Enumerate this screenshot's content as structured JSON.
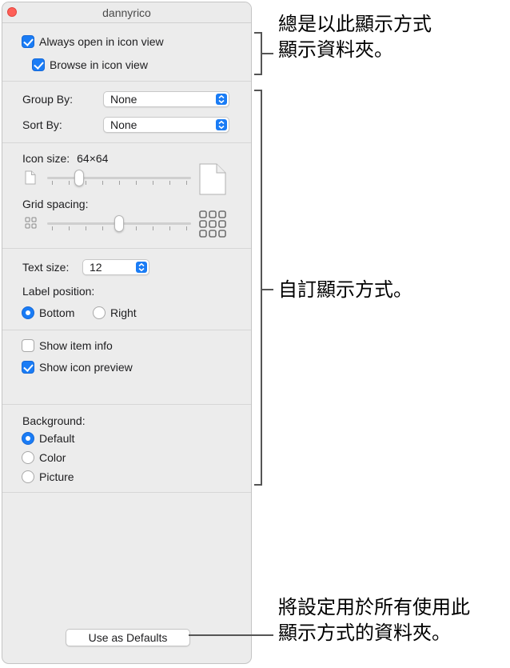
{
  "window": {
    "title": "dannyrico"
  },
  "view": {
    "always_open_label": "Always open in icon view",
    "always_open_checked": true,
    "browse_label": "Browse in icon view",
    "browse_checked": true
  },
  "arrange": {
    "group_by_label": "Group By:",
    "group_by_value": "None",
    "sort_by_label": "Sort By:",
    "sort_by_value": "None"
  },
  "icon_size": {
    "label": "Icon size:",
    "value": "64×64",
    "slider_fraction": 0.2
  },
  "grid_spacing": {
    "label": "Grid spacing:",
    "slider_fraction": 0.5
  },
  "text": {
    "text_size_label": "Text size:",
    "text_size_value": "12",
    "label_position_label": "Label position:",
    "options": [
      {
        "label": "Bottom",
        "selected": true
      },
      {
        "label": "Right",
        "selected": false
      }
    ]
  },
  "info": {
    "show_item_info_label": "Show item info",
    "show_item_info_checked": false,
    "show_icon_preview_label": "Show icon preview",
    "show_icon_preview_checked": true
  },
  "background": {
    "label": "Background:",
    "options": [
      {
        "label": "Default",
        "selected": true
      },
      {
        "label": "Color",
        "selected": false
      },
      {
        "label": "Picture",
        "selected": false
      }
    ]
  },
  "footer": {
    "use_as_defaults_label": "Use as Defaults"
  },
  "annotations": {
    "top_line1": "總是以此顯示方式",
    "top_line2": "顯示資料夾。",
    "middle": "自訂顯示方式。",
    "bottom_line1": "將設定用於所有使用此",
    "bottom_line2": "顯示方式的資料夾。"
  },
  "colors": {
    "accent": "#1a7cf5",
    "close": "#fe5f57"
  }
}
